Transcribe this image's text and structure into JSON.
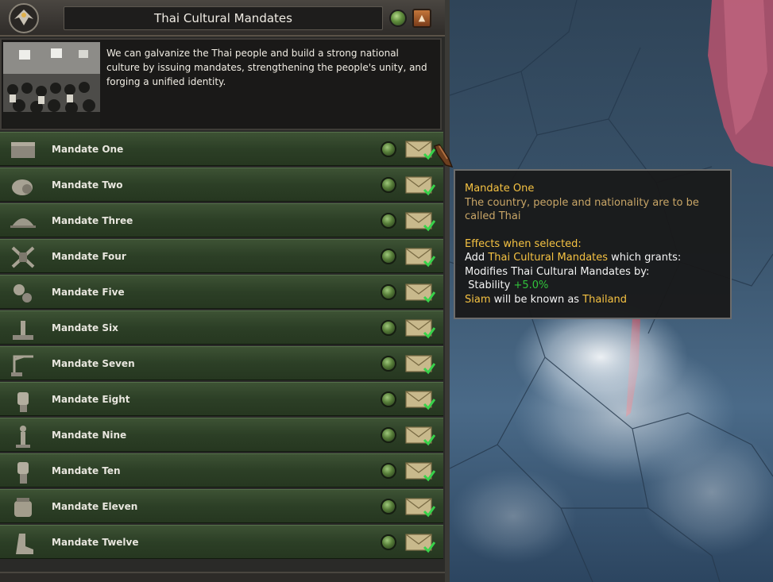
{
  "header": {
    "title": "Thai Cultural Mandates",
    "emblem_icon": "eagle-emblem-icon",
    "collapse_icon": "chevron-up-icon"
  },
  "intro": {
    "image": "crowd-photo",
    "text": "We can galvanize the Thai people and build a strong national culture by issuing mandates, strengthening the people's unity, and forging a unified identity."
  },
  "mandates": [
    {
      "label": "Mandate One",
      "icon": "flag-icon"
    },
    {
      "label": "Mandate Two",
      "icon": "helmet-gear-icon"
    },
    {
      "label": "Mandate Three",
      "icon": "army-helmet-icon"
    },
    {
      "label": "Mandate Four",
      "icon": "crossed-tools-icon"
    },
    {
      "label": "Mandate Five",
      "icon": "gears-icon"
    },
    {
      "label": "Mandate Six",
      "icon": "monument-icon"
    },
    {
      "label": "Mandate Seven",
      "icon": "crane-icon"
    },
    {
      "label": "Mandate Eight",
      "icon": "fist-icon"
    },
    {
      "label": "Mandate Nine",
      "icon": "figure-icon"
    },
    {
      "label": "Mandate Ten",
      "icon": "raised-fist-icon"
    },
    {
      "label": "Mandate Eleven",
      "icon": "jar-icon"
    },
    {
      "label": "Mandate Twelve",
      "icon": "boot-icon"
    }
  ],
  "tooltip": {
    "title": "Mandate One",
    "description": "The country, people and nationality are to be called Thai",
    "effects_header": "Effects when selected:",
    "line1_prefix": "Add ",
    "line1_highlight": "Thai Cultural Mandates",
    "line1_suffix": " which grants:",
    "line2": "Modifies Thai Cultural Mandates by:",
    "line3_label": "Stability",
    "line3_value": "+5.0%",
    "line4_subject": "Siam",
    "line4_middle": " will be known as ",
    "line4_target": "Thailand"
  },
  "colors": {
    "accent_yellow": "#f5c242",
    "positive_green": "#31c43b",
    "row_green": "#2c3f26"
  }
}
